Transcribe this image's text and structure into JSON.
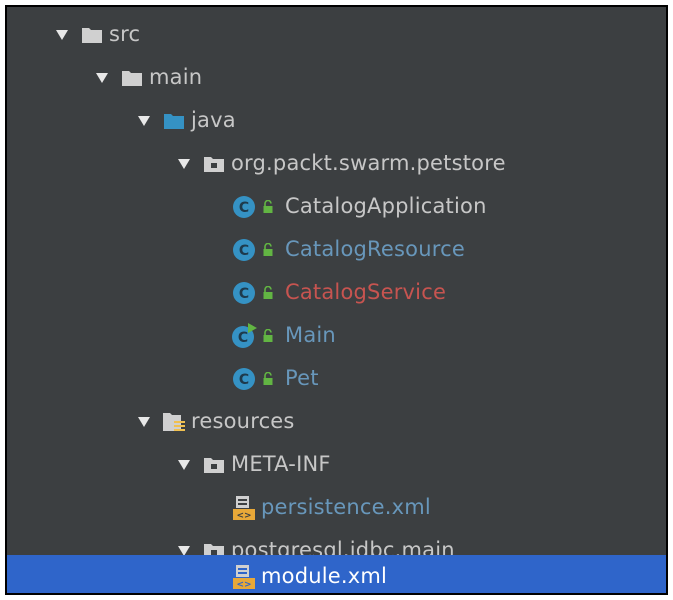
{
  "tree": {
    "items": [
      {
        "label": "src",
        "icon": "folder-icon",
        "expanded": true
      },
      {
        "label": "main",
        "icon": "folder-icon",
        "expanded": true
      },
      {
        "label": "java",
        "icon": "source-folder-icon",
        "expanded": true
      },
      {
        "label": "org.packt.swarm.petstore",
        "icon": "package-icon",
        "expanded": true
      },
      {
        "label": "CatalogApplication",
        "icon": "class-icon",
        "status": "unmodified"
      },
      {
        "label": "CatalogResource",
        "icon": "class-icon",
        "status": "modified"
      },
      {
        "label": "CatalogService",
        "icon": "class-icon",
        "status": "error"
      },
      {
        "label": "Main",
        "icon": "runnable-class-icon",
        "status": "modified"
      },
      {
        "label": "Pet",
        "icon": "class-icon",
        "status": "modified"
      },
      {
        "label": "resources",
        "icon": "resources-folder-icon",
        "expanded": true
      },
      {
        "label": "META-INF",
        "icon": "package-icon",
        "expanded": true
      },
      {
        "label": "persistence.xml",
        "icon": "xml-file-icon",
        "status": "modified"
      },
      {
        "label": "postgresql.jdbc.main",
        "icon": "package-icon",
        "expanded": true
      },
      {
        "label": "module.xml",
        "icon": "xml-file-icon",
        "selected": true
      }
    ]
  },
  "colors": {
    "background": "#3c3f41",
    "selection": "#2f65ca",
    "text": "#bbbbbb",
    "modified": "#6897bb",
    "error": "#c75450",
    "class_icon": "#3592c4",
    "access_icon": "#62b543"
  }
}
